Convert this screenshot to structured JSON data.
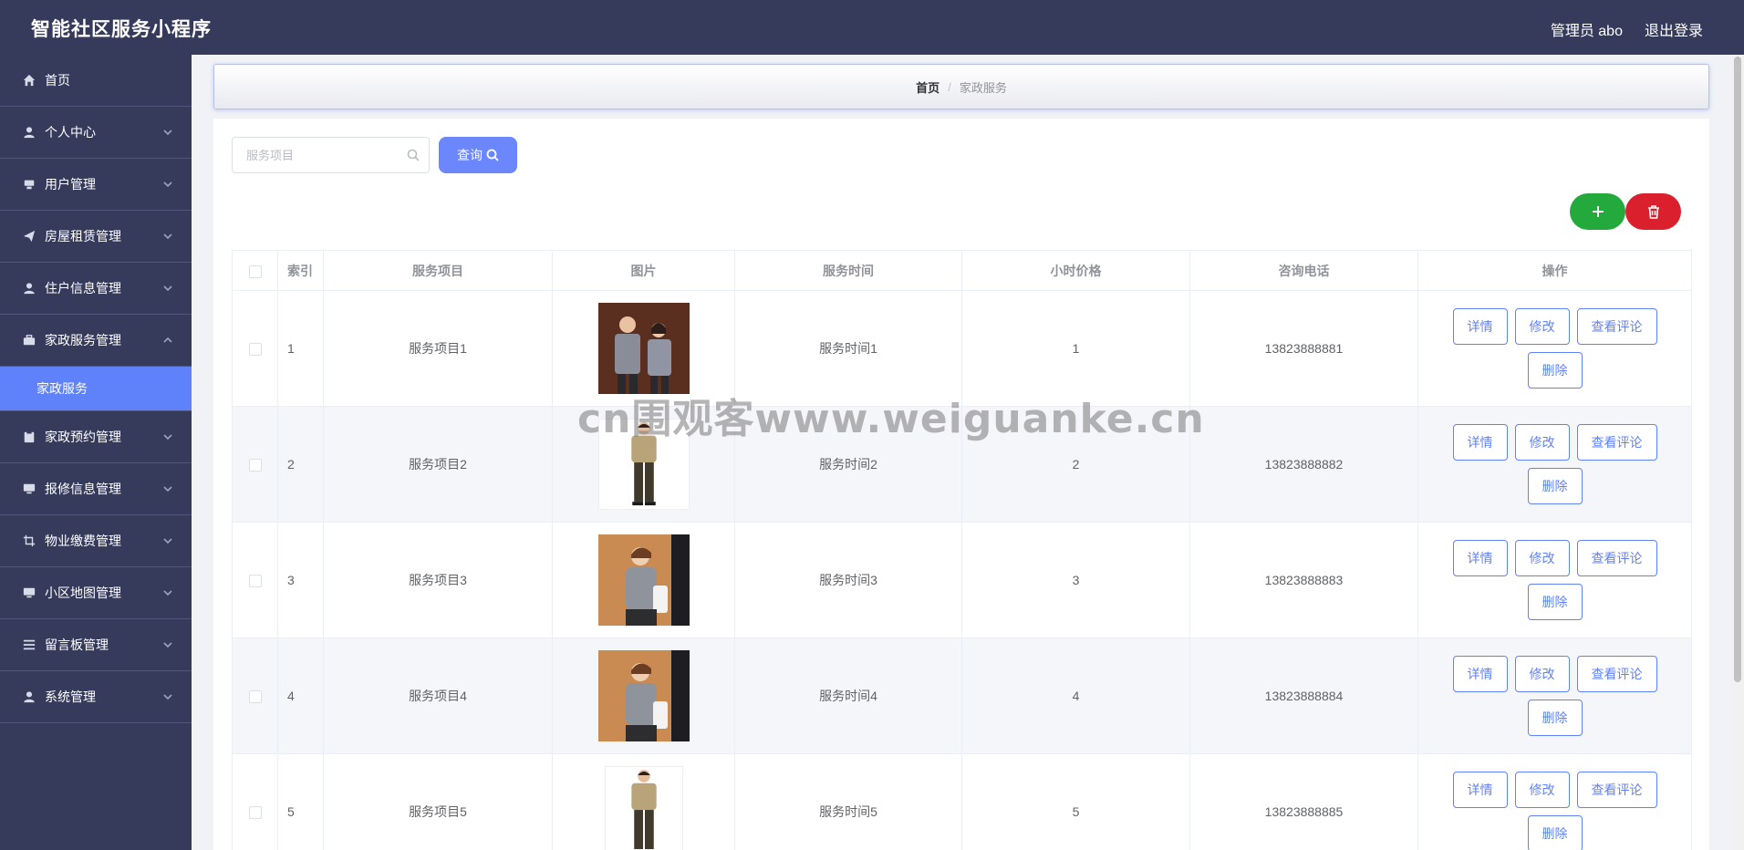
{
  "header": {
    "title": "智能社区服务小程序",
    "admin_label": "管理员 abo",
    "logout_label": "退出登录"
  },
  "sidebar": {
    "items": [
      {
        "label": "首页",
        "icon": "home-icon"
      },
      {
        "label": "个人中心",
        "icon": "user-icon"
      },
      {
        "label": "用户管理",
        "icon": "users-icon"
      },
      {
        "label": "房屋租赁管理",
        "icon": "send-icon"
      },
      {
        "label": "住户信息管理",
        "icon": "user-icon"
      },
      {
        "label": "家政服务管理",
        "icon": "briefcase-icon",
        "expanded": true
      },
      {
        "label": "家政预约管理",
        "icon": "clipboard-icon"
      },
      {
        "label": "报修信息管理",
        "icon": "monitor-icon"
      },
      {
        "label": "物业缴费管理",
        "icon": "crop-icon"
      },
      {
        "label": "小区地图管理",
        "icon": "monitor-icon"
      },
      {
        "label": "留言板管理",
        "icon": "list-icon"
      },
      {
        "label": "系统管理",
        "icon": "user-icon"
      }
    ],
    "active_sub": "家政服务"
  },
  "breadcrumb": {
    "home": "首页",
    "separator": "/",
    "current": "家政服务"
  },
  "search": {
    "placeholder": "服务项目",
    "query_label": "查询"
  },
  "table": {
    "headers": [
      "索引",
      "服务项目",
      "图片",
      "服务时间",
      "小时价格",
      "咨询电话",
      "操作"
    ],
    "rows": [
      {
        "index": "1",
        "item": "服务项目1",
        "time": "服务时间1",
        "price": "1",
        "phone": "13823888881"
      },
      {
        "index": "2",
        "item": "服务项目2",
        "time": "服务时间2",
        "price": "2",
        "phone": "13823888882"
      },
      {
        "index": "3",
        "item": "服务项目3",
        "time": "服务时间3",
        "price": "3",
        "phone": "13823888883"
      },
      {
        "index": "4",
        "item": "服务项目4",
        "time": "服务时间4",
        "price": "4",
        "phone": "13823888884"
      },
      {
        "index": "5",
        "item": "服务项目5",
        "time": "服务时间5",
        "price": "5",
        "phone": "13823888885"
      }
    ],
    "ops": {
      "detail": "详情",
      "edit": "修改",
      "comments": "查看评论",
      "delete": "删除"
    }
  },
  "watermark": "cn围观客www.weiguanke.cn",
  "colors": {
    "header_bg": "#363b5c",
    "accent": "#5f81fa",
    "add": "#23a93c",
    "delete": "#d9202c"
  }
}
